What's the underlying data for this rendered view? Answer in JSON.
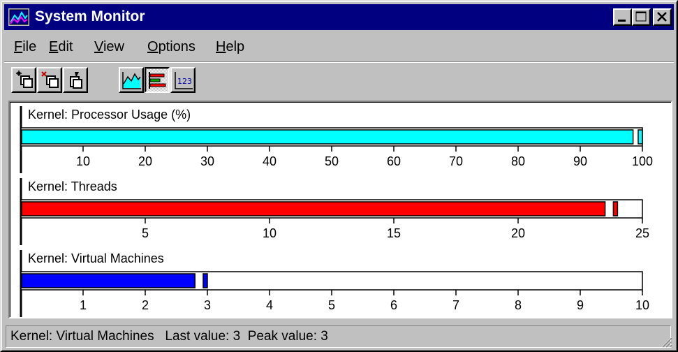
{
  "window": {
    "title": "System Monitor"
  },
  "menu": {
    "items": [
      {
        "label": "File",
        "underline": "F",
        "rest": "ile"
      },
      {
        "label": "Edit",
        "underline": "E",
        "rest": "dit"
      },
      {
        "label": "View",
        "underline": "V",
        "rest": "iew"
      },
      {
        "label": "Options",
        "underline": "O",
        "rest": "ptions"
      },
      {
        "label": "Help",
        "underline": "H",
        "rest": "elp"
      }
    ]
  },
  "toolbar": {
    "buttons": [
      {
        "name": "add-item-button",
        "icon": "add-item-icon"
      },
      {
        "name": "remove-item-button",
        "icon": "remove-item-icon"
      },
      {
        "name": "edit-item-button",
        "icon": "edit-item-icon"
      },
      {
        "name": "line-chart-button",
        "icon": "line-chart-icon"
      },
      {
        "name": "bar-chart-button",
        "icon": "bar-chart-icon",
        "pressed": true
      },
      {
        "name": "numeric-chart-button",
        "icon": "numeric-chart-icon",
        "label": "123"
      }
    ]
  },
  "chart_data": [
    {
      "type": "bar",
      "title": "Kernel: Processor Usage (%)",
      "current": 98.5,
      "peak": 100,
      "xlim": [
        0,
        100
      ],
      "ticks": [
        "10",
        "20",
        "30",
        "40",
        "50",
        "60",
        "70",
        "80",
        "90",
        "100"
      ],
      "color": "#00ffff"
    },
    {
      "type": "bar",
      "title": "Kernel: Threads",
      "current": 23.5,
      "peak": 24,
      "xlim": [
        0,
        25
      ],
      "ticks": [
        "5",
        "10",
        "15",
        "20",
        "25"
      ],
      "color": "#ff0000"
    },
    {
      "type": "bar",
      "title": "Kernel: Virtual Machines",
      "current": 2.8,
      "peak": 3,
      "xlim": [
        0,
        10
      ],
      "ticks": [
        "1",
        "2",
        "3",
        "4",
        "5",
        "6",
        "7",
        "8",
        "9",
        "10"
      ],
      "color": "#0000ff"
    }
  ],
  "status": {
    "text": "Kernel: Virtual Machines   Last value: 3  Peak value: 3"
  }
}
